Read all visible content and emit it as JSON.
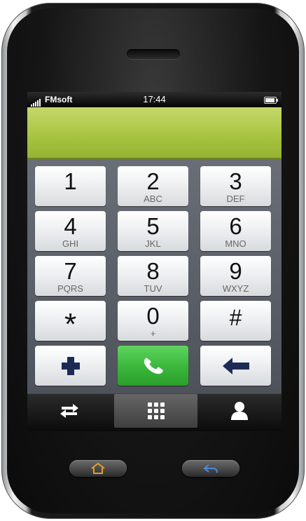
{
  "status_bar": {
    "carrier": "FMsoft",
    "time": "17:44",
    "signal_icon": "signal-bars-icon",
    "battery_icon": "battery-icon"
  },
  "display": {
    "dialed_number": ""
  },
  "keypad": {
    "keys": [
      {
        "digit": "1",
        "letters": ""
      },
      {
        "digit": "2",
        "letters": "ABC"
      },
      {
        "digit": "3",
        "letters": "DEF"
      },
      {
        "digit": "4",
        "letters": "GHI"
      },
      {
        "digit": "5",
        "letters": "JKL"
      },
      {
        "digit": "6",
        "letters": "MNO"
      },
      {
        "digit": "7",
        "letters": "PQRS"
      },
      {
        "digit": "8",
        "letters": "TUV"
      },
      {
        "digit": "9",
        "letters": "WXYZ"
      },
      {
        "digit": "*",
        "letters": ""
      },
      {
        "digit": "0",
        "letters": "+"
      },
      {
        "digit": "#",
        "letters": ""
      }
    ],
    "actions": {
      "add_icon": "plus-icon",
      "call_icon": "phone-icon",
      "delete_icon": "backspace-arrow-icon"
    }
  },
  "tab_bar": {
    "tabs": [
      {
        "icon": "swap-arrows-icon",
        "active": false
      },
      {
        "icon": "keypad-grid-icon",
        "active": true
      },
      {
        "icon": "contact-person-icon",
        "active": false
      }
    ]
  },
  "hardware_buttons": {
    "home_icon": "home-icon",
    "back_icon": "back-arrow-icon"
  },
  "colors": {
    "display_green": "#a6c23e",
    "call_green": "#3db83d",
    "icon_navy": "#1c2b55",
    "home_orange": "#e0a030",
    "back_blue": "#4a8ad8"
  }
}
